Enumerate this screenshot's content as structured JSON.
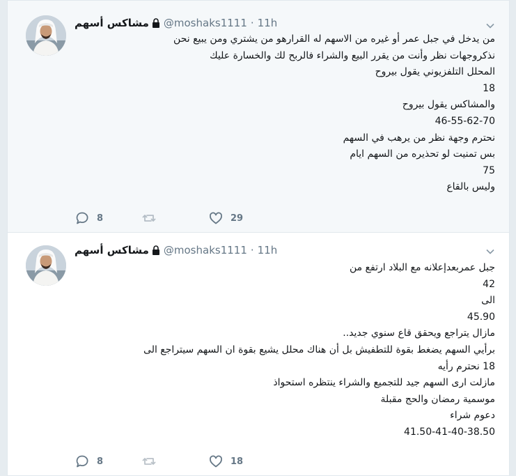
{
  "tweets": [
    {
      "author_name": "مشاكس أسهم",
      "handle": "@moshaks1111",
      "separator": "·",
      "time": "11h",
      "lines": [
        {
          "text": "من يدخل في جبل عمر أو غيره من الاسهم له القرارهو من يشتري ومن يبيع نحن",
          "ltr": false
        },
        {
          "text": "نذكروجهات نظر وأنت من يقرر البيع والشراء فالربح لك والخسارة عليك",
          "ltr": false
        },
        {
          "text": "المحلل التلفزيوني يقول بيروح",
          "ltr": false
        },
        {
          "text": "18",
          "ltr": true
        },
        {
          "text": "والمشاكس يقول بيروح",
          "ltr": false
        },
        {
          "text": "46-55-62-70",
          "ltr": true
        },
        {
          "text": "نحترم وجهة نظر من يرهب في السهم",
          "ltr": false
        },
        {
          "text": "بس تمنيت لو تحذيره من السهم ايام",
          "ltr": false
        },
        {
          "text": "75",
          "ltr": true
        },
        {
          "text": "وليس بالقاع",
          "ltr": false
        }
      ],
      "reply_count": "8",
      "retweet_count": "",
      "like_count": "29"
    },
    {
      "author_name": "مشاكس أسهم",
      "handle": "@moshaks1111",
      "separator": "·",
      "time": "11h",
      "lines": [
        {
          "text": "جبل عمربعدإعلانه مع البلاد ارتفع من",
          "ltr": false
        },
        {
          "text": "42",
          "ltr": true
        },
        {
          "text": "الى",
          "ltr": false
        },
        {
          "text": "45.90",
          "ltr": true
        },
        {
          "text": "مازال يتراجع ويحقق قاع سنوي جديد..",
          "ltr": false
        },
        {
          "text": "برأيي السهم يضغط بقوة للتطفيش بل أن هناك محلل يشيع بقوة ان السهم سيتراجع الى",
          "ltr": false
        },
        {
          "text": "18 نحترم رأيه",
          "ltr": false
        },
        {
          "text": "مازلت ارى السهم جيد للتجميع والشراء ينتظره استحواذ",
          "ltr": false
        },
        {
          "text": "موسمية رمضان والحج مقبلة",
          "ltr": false
        },
        {
          "text": "دعوم شراء",
          "ltr": false
        },
        {
          "text": "41.50-41-40-38.50",
          "ltr": true
        }
      ],
      "reply_count": "8",
      "retweet_count": "",
      "like_count": "18"
    }
  ],
  "icons": {
    "lock": "lock-icon",
    "chevron": "chevron-down-icon",
    "reply": "reply-icon",
    "retweet": "retweet-icon",
    "like": "heart-icon"
  },
  "colors": {
    "background": "#e6ecf0",
    "tweet_hover_bg": "#f5f8fa",
    "secondary_text": "#657786",
    "primary_text": "#14171a"
  }
}
